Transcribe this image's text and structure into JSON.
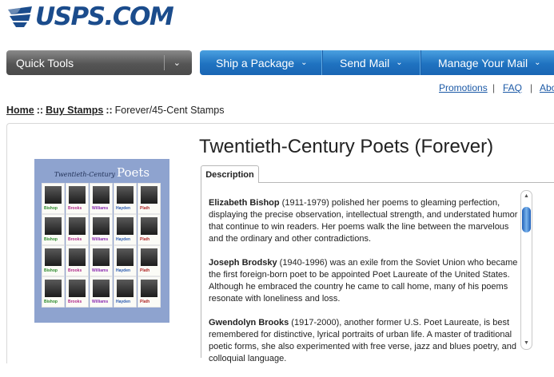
{
  "header": {
    "logo_text": "USPS.COM"
  },
  "nav": {
    "quick_tools": "Quick Tools",
    "items": [
      {
        "label": "Ship a Package"
      },
      {
        "label": "Send Mail"
      },
      {
        "label": "Manage Your Mail"
      }
    ]
  },
  "utility_links": {
    "promotions": "Promotions",
    "faq": "FAQ",
    "about": "Abo",
    "separator": "|"
  },
  "breadcrumb": {
    "home": "Home",
    "buy_stamps": "Buy Stamps",
    "current": "Forever/45-Cent Stamps",
    "separator": "::"
  },
  "product": {
    "title": "Twentieth-Century Poets (Forever)",
    "image": {
      "sheet_title_script": "Twentieth-Century",
      "sheet_title_word": "Poets",
      "stamp_names": [
        "Bishop",
        "Brooks",
        "Williams",
        "Hayden",
        "Plath",
        "Bishop",
        "Brooks",
        "Williams",
        "Hayden",
        "Plath",
        "Bishop",
        "Brooks",
        "Williams",
        "Hayden",
        "Plath",
        "Bishop",
        "Brooks",
        "Williams",
        "Hayden",
        "Plath"
      ]
    },
    "tab_label": "Description",
    "paragraphs": [
      {
        "name": "Elizabeth Bishop",
        "text": " (1911-1979) polished her poems to gleaming perfection, displaying the precise observation, intellectual strength, and understated humor that continue to win readers. Her poems walk the line between the marvelous and the ordinary and other contradictions."
      },
      {
        "name": "Joseph Brodsky",
        "text": " (1940-1996) was an exile from the Soviet Union who became the first foreign-born poet to be appointed Poet Laureate of the United States. Although he embraced the country he came to call home, many of his poems resonate with loneliness and loss."
      },
      {
        "name": "Gwendolyn Brooks",
        "text": " (1917-2000), another former U.S. Poet Laureate, is best remembered for distinctive, lyrical portraits of urban life. A master of traditional poetic forms, she also experimented with free verse, jazz and blues poetry, and colloquial language."
      }
    ]
  },
  "colors": {
    "brand_blue": "#1b4c8c",
    "nav_blue": "#1f72c0",
    "link": "#1b59a6"
  }
}
